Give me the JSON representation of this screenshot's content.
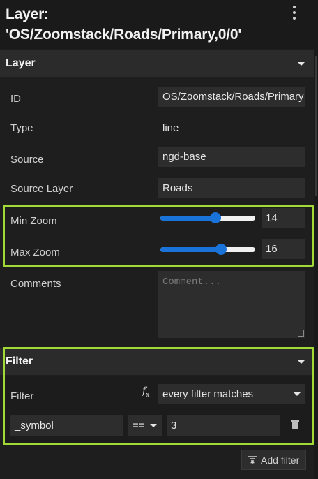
{
  "header": {
    "title_line1": "Layer:",
    "title_line2": "'OS/Zoomstack/Roads/Primary,0/0'",
    "menu_icon": "more-vertical-icon"
  },
  "layer_section": {
    "title": "Layer",
    "fields": {
      "id": {
        "label": "ID",
        "value": "OS/Zoomstack/Roads/Primary"
      },
      "type": {
        "label": "Type",
        "value": "line"
      },
      "source": {
        "label": "Source",
        "value": "ngd-base"
      },
      "source_layer": {
        "label": "Source Layer",
        "value": "Roads"
      },
      "min_zoom": {
        "label": "Min Zoom",
        "value": "14",
        "slider_fraction": 0.58
      },
      "max_zoom": {
        "label": "Max Zoom",
        "value": "16",
        "slider_fraction": 0.64
      },
      "comments": {
        "label": "Comments",
        "placeholder": "Comment..."
      }
    }
  },
  "filter_section": {
    "title": "Filter",
    "filter_label": "Filter",
    "mode_value": "every filter matches",
    "expression_icon": "function-icon",
    "rule": {
      "key": "_symbol",
      "operator": "==",
      "value": "3"
    },
    "add_filter_label": "Add filter",
    "add_filter_icon": "add-filter-icon"
  },
  "colors": {
    "highlight": "#a3d936",
    "slider_accent": "#1a73d9",
    "background": "#1e1e1e"
  }
}
